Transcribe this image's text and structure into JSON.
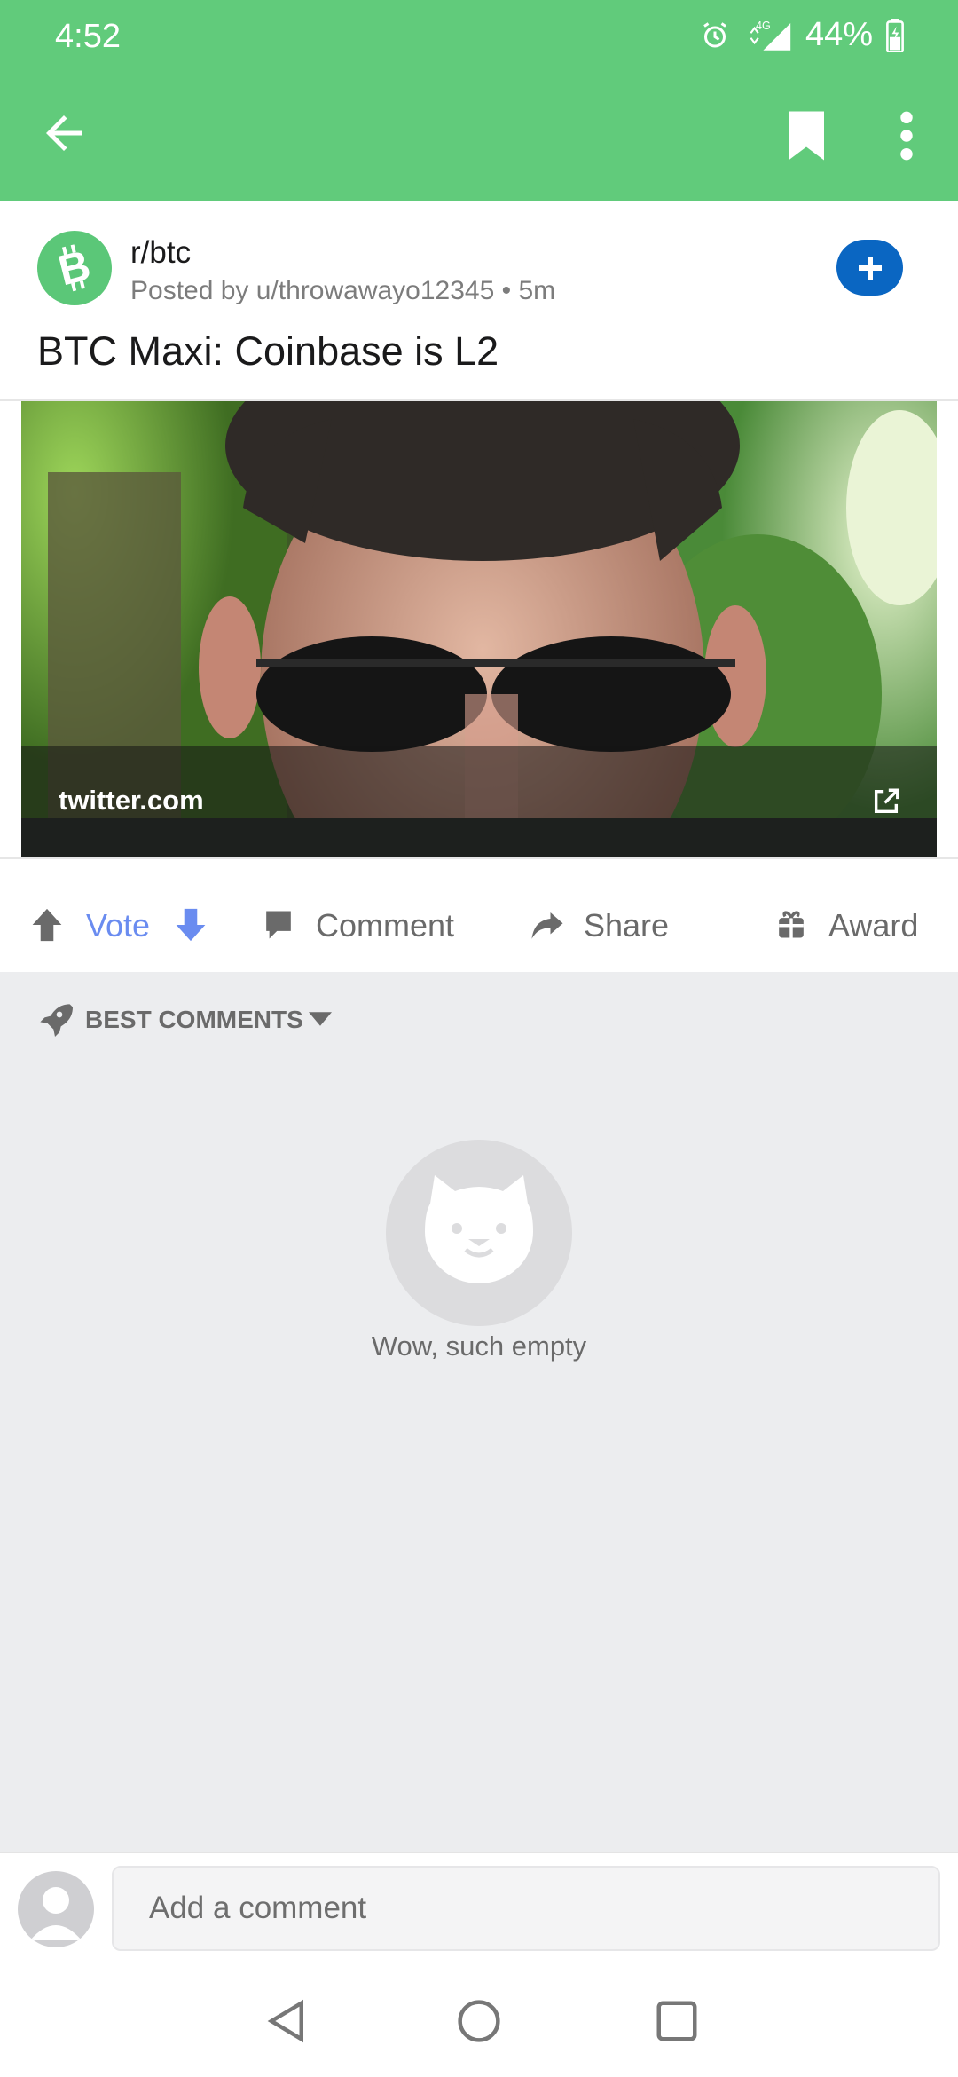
{
  "status_bar": {
    "time": "4:52",
    "network": "4G",
    "battery": "44%"
  },
  "app_bar": {
    "icons": [
      "back-arrow-icon",
      "bookmark-icon",
      "more-vert-icon"
    ]
  },
  "post": {
    "subreddit": "r/btc",
    "meta": "Posted by u/throwawayo12345 • 5m",
    "title": "BTC Maxi: Coinbase is L2",
    "link_domain": "twitter.com"
  },
  "actions": {
    "vote": "Vote",
    "comment": "Comment",
    "share": "Share",
    "award": "Award"
  },
  "comments": {
    "sort_label": "BEST COMMENTS",
    "empty_text": "Wow, such empty"
  },
  "composer": {
    "placeholder": "Add a comment"
  },
  "colors": {
    "header_green": "#61cb7b",
    "vote_blue": "#6a8cf0",
    "join_blue": "#0a66c2"
  }
}
